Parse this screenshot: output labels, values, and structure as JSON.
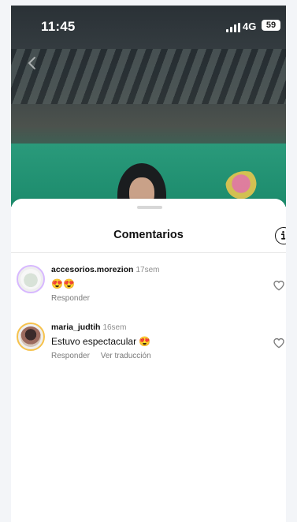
{
  "status_bar": {
    "time": "11:45",
    "network": "4G",
    "battery": "59"
  },
  "icons": {
    "back": "chevron-left-icon",
    "info": "info-icon",
    "like": "heart-outline-icon"
  },
  "sheet": {
    "title": "Comentarios"
  },
  "comments": [
    {
      "username": "accesorios.morezion",
      "time": "17sem",
      "text": "😍😍",
      "actions": [
        "Responder"
      ]
    },
    {
      "username": "maria_judtih",
      "time": "16sem",
      "text": "Estuvo espectacular 😍",
      "actions": [
        "Responder",
        "Ver traducción"
      ]
    }
  ],
  "colors": {
    "sheet_background": "#ffffff",
    "secondary_text": "#8e8e8e",
    "primary_text": "#111111"
  }
}
